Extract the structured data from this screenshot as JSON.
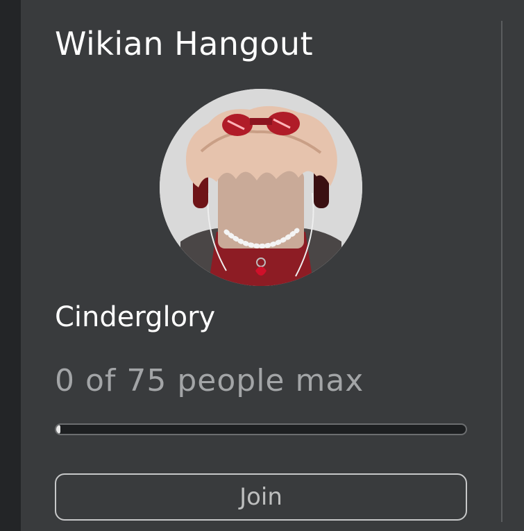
{
  "server": {
    "title": "Wikian Hangout",
    "owner": "Cinderglory",
    "avatar_icon": "player-avatar-headshot",
    "capacity_text": "0 of 75 people max",
    "capacity_fill": 0.0,
    "join_label": "Join"
  },
  "colors": {
    "background": "#393b3d",
    "left_strip": "#232527",
    "title_text": "#ffffff",
    "muted_text": "#a3a5a7",
    "bar_track": "#1d1f21",
    "button_border": "#c7c8c9"
  }
}
